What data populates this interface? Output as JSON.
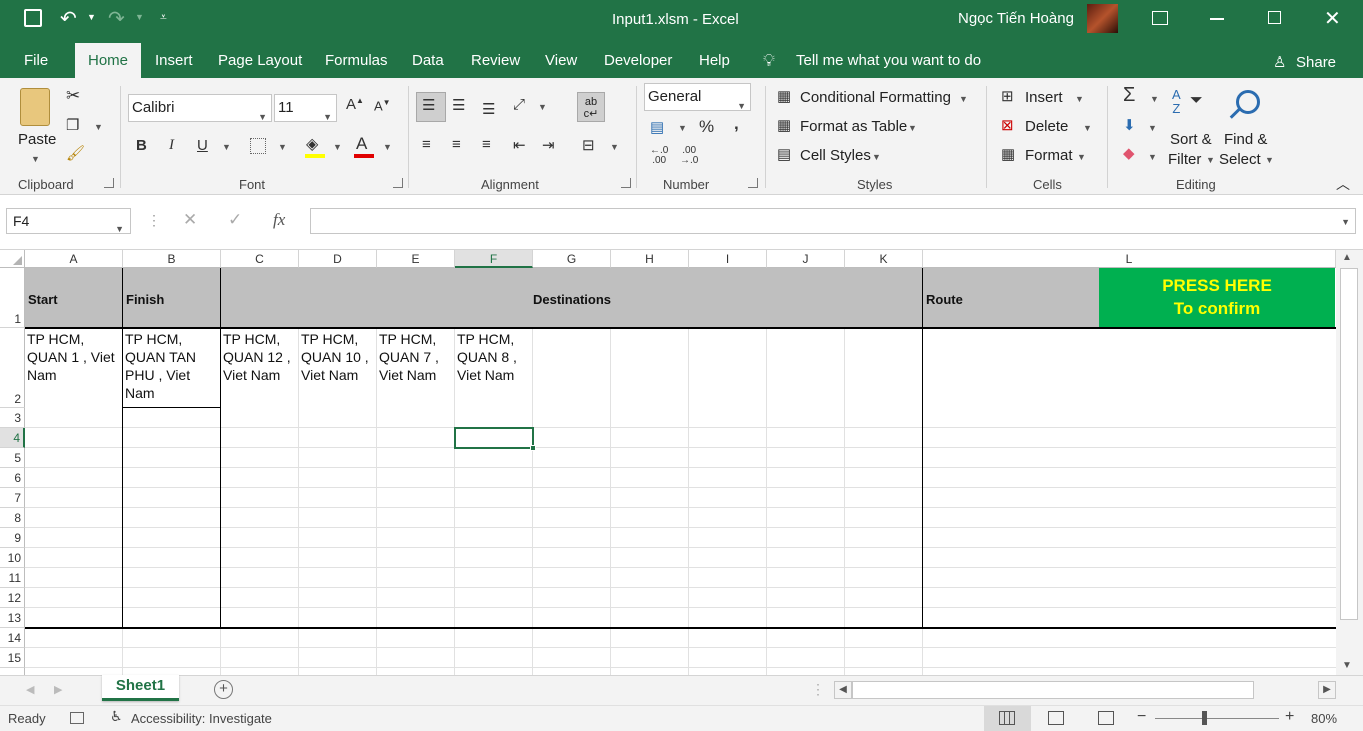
{
  "window": {
    "title": "Input1.xlsm  -  Excel",
    "user": "Ngọc Tiến Hoàng"
  },
  "tabs": [
    "File",
    "Home",
    "Insert",
    "Page Layout",
    "Formulas",
    "Data",
    "Review",
    "View",
    "Developer",
    "Help"
  ],
  "tell_me": "Tell me what you want to do",
  "share": "Share",
  "ribbon": {
    "clipboard": {
      "paste": "Paste",
      "label": "Clipboard"
    },
    "font": {
      "name": "Calibri",
      "size": "11",
      "label": "Font",
      "bold": "B",
      "italic": "I",
      "underline": "U"
    },
    "alignment": {
      "label": "Alignment"
    },
    "number": {
      "format": "General",
      "label": "Number",
      "percent": "%",
      "comma": ","
    },
    "styles": {
      "conditional": "Conditional Formatting",
      "table": "Format as Table",
      "cell_styles": "Cell Styles",
      "label": "Styles"
    },
    "cells": {
      "insert": "Insert",
      "delete": "Delete",
      "format": "Format",
      "label": "Cells"
    },
    "editing": {
      "sort1": "Sort &",
      "sort2": "Filter",
      "find1": "Find &",
      "find2": "Select",
      "label": "Editing"
    }
  },
  "formula_bar": {
    "name_box": "F4",
    "fx": "fx",
    "content": ""
  },
  "columns": [
    "A",
    "B",
    "C",
    "D",
    "E",
    "F",
    "G",
    "H",
    "I",
    "J",
    "K",
    "L"
  ],
  "rows": [
    "1",
    "2",
    "3",
    "4",
    "5",
    "6",
    "7",
    "8",
    "9",
    "10",
    "11",
    "12",
    "13",
    "14",
    "15"
  ],
  "cells": {
    "A1": "Start",
    "B1": "Finish",
    "C1": "Destinations",
    "K1": "Route",
    "L1_line1": "PRESS HERE",
    "L1_line2": "To confirm",
    "A2": "TP HCM, QUAN 1 , Viet Nam",
    "B2": "TP HCM, QUAN TAN PHU , Viet Nam",
    "C2": "TP HCM, QUAN 12 , Viet Nam",
    "D2": "TP HCM, QUAN 10 , Viet Nam",
    "E2": "TP HCM, QUAN 7 , Viet Nam",
    "F2": "TP HCM, QUAN 8 , Viet Nam"
  },
  "sheet_tab": "Sheet1",
  "status": {
    "ready": "Ready",
    "accessibility": "Accessibility: Investigate",
    "zoom": "80%"
  },
  "colors": {
    "brand": "#217346",
    "button": "#00b050",
    "button_text": "#ffff00",
    "header_fill": "#bfbfbf"
  }
}
